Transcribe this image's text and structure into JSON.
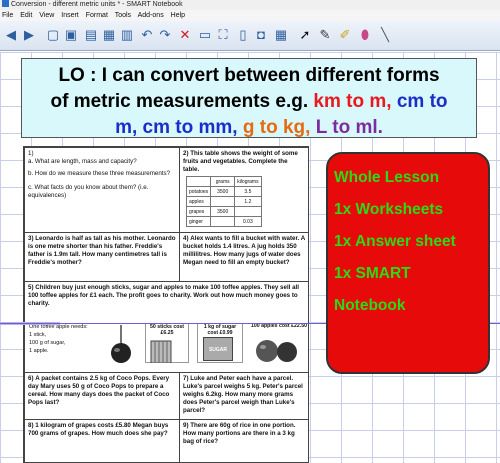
{
  "window": {
    "title": "Conversion - different metric units * - SMART Notebook"
  },
  "menu": [
    "File",
    "Edit",
    "View",
    "Insert",
    "Format",
    "Tools",
    "Add-ons",
    "Help"
  ],
  "toolbar_icons": [
    "back-icon",
    "forward-icon",
    "add-page-icon",
    "delete-page-icon",
    "open-icon",
    "save-icon",
    "paste-icon",
    "undo-icon",
    "redo-icon",
    "delete-icon",
    "screen-shade-icon",
    "full-screen-icon",
    "dual-page-icon",
    "capture-icon",
    "table-icon",
    "select-icon",
    "pen-icon",
    "highlighter-icon",
    "eraser-icon",
    "line-icon"
  ],
  "lo": {
    "line1": "LO : I can convert between different forms",
    "line2": "of metric measurements e.g.",
    "km_to_m": "km to m,",
    "cm_to": "cm to",
    "m": "m,",
    "cm_to_mm": "cm to mm,",
    "g_to_kg": "g to kg,",
    "l_to_ml": "L to ml."
  },
  "worksheet": {
    "q1_num": "1)",
    "q1a": "a.  What are length, mass and capacity?",
    "q1b": "b.  How do we measure these three measurements?",
    "q1c": "c.  What facts do you know about them? (i.e. equivalences)",
    "q2_num": "2)",
    "q2_text": "This table shows the weight of some fruits and vegetables. Complete the table.",
    "table_headers": [
      "",
      "grams",
      "kilograms"
    ],
    "table_rows": [
      [
        "potatoes",
        "3500",
        "3.5"
      ],
      [
        "apples",
        "",
        "1.2"
      ],
      [
        "grapes",
        "3500",
        ""
      ],
      [
        "ginger",
        "",
        "0.03"
      ]
    ],
    "q3_num": "3)",
    "q3_text": "Leonardo is half as tall as his mother. Leonardo is one metre shorter than his father. Freddie's father is 1.9m tall. How many centimetres tall is Freddie's mother?",
    "q4_num": "4)",
    "q4_text": "Alex wants to fill a bucket with water. A bucket holds 1.4 litres. A jug holds 350 millilitres. How many jugs of water does Megan need to fill an empty bucket?",
    "q5_num": "5)",
    "q5_text": "Children buy just enough sticks, sugar and apples to make 100 toffee apples. They sell all 100 toffee apples for £1 each. The profit goes to charity. Work out how much money goes to charity.",
    "recipe_title": "One toffee apple needs:",
    "recipe_1": "1 stick,",
    "recipe_2": "100 g of sugar,",
    "recipe_3": "1 apple.",
    "sticks_label": "50 sticks cost £6.25",
    "sugar_label": "1 kg of sugar cost £0.99",
    "apples_label": "100 apples cost £22.50",
    "sugar_bag_text": "SUGAR",
    "q6_num": "6)",
    "q6_text": "A packet contains 2.5 kg of Coco Pops. Every day Mary uses 50 g of Coco Pops to prepare a cereal. How many days does the packet of Coco Pops last?",
    "q7_num": "7)",
    "q7_text": "Luke and Peter each have a parcel. Luke's parcel weighs 5 kg. Peter's parcel weighs 6.2kg. How many more grams does Peter's parcel weigh than Luke's parcel?",
    "q8_num": "8)",
    "q8_text": "1 kilogram of grapes costs £5.80 Megan buys 700 grams of grapes. How much does she pay?",
    "q9_num": "9)",
    "q9_text": "There are 60g of rice in one portion. How many portions are there in a 3 kg bag of rice?"
  },
  "promo": {
    "line1": "Whole Lesson",
    "line2": "1x Worksheets",
    "line3": "1x Answer sheet",
    "line4": "1x SMART",
    "line5": "Notebook"
  },
  "colors": {
    "lo_bg": "#d8f8fb",
    "promo_bg": "#e60a0a",
    "promo_text": "#2bdc14"
  }
}
